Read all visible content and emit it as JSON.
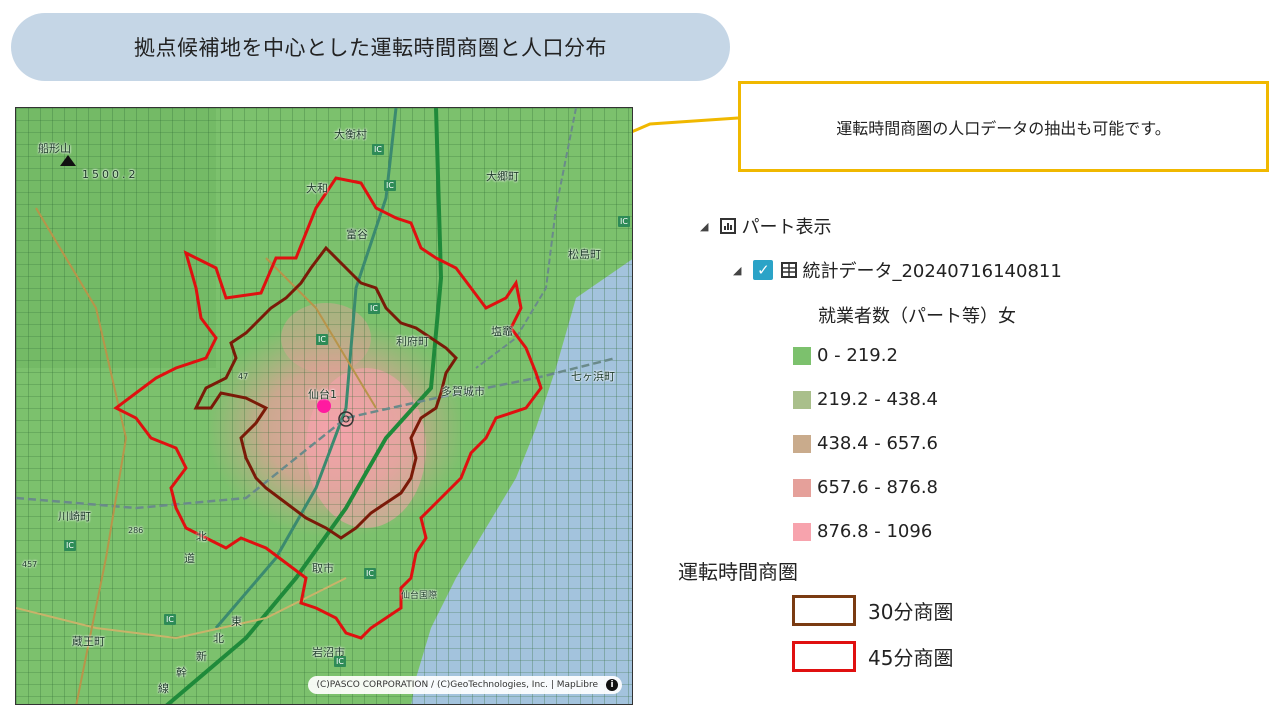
{
  "title": "拠点候補地を中心とした運転時間商圏と人口分布",
  "callout": "運転時間商圏の人口データの抽出も可能です。",
  "map": {
    "labels": {
      "mountain": "船形山",
      "elevation": "1500.2",
      "taiwa_mura": "大衡村",
      "daigo_machi": "大郷町",
      "taiwa": "大和",
      "tomiya": "富谷",
      "matsushima": "松島町",
      "rifu": "利府町",
      "shiogama": "塩竈",
      "shichigahama": "七ヶ浜町",
      "tagajo": "多賀城市",
      "sendai": "仙台1",
      "kawasaki": "川崎町",
      "natori": "取市",
      "airport": "仙台国際",
      "zao": "蔵王町",
      "iwanuma": "岩沼市",
      "kita": "北",
      "michi": "道",
      "higashi": "東",
      "shin": "新",
      "kan": "幹",
      "sen": "線",
      "route457": "457",
      "route286": "286",
      "route47": "47"
    },
    "ic_label": "IC",
    "attribution": "(C)PASCO CORPORATION / (C)GeoTechnologies, Inc. | MapLibre",
    "info_icon": "i"
  },
  "panel": {
    "part_label": "パート表示",
    "dataset_label": "統計データ_20240716140811",
    "metric_label": "就業者数（パート等）女",
    "legend": [
      {
        "label": "0 - 219.2",
        "color": "#7cc16d"
      },
      {
        "label": "219.2 - 438.4",
        "color": "#a9bf8b"
      },
      {
        "label": "438.4 - 657.6",
        "color": "#c9ab8c"
      },
      {
        "label": "657.6 - 876.8",
        "color": "#e5a09a"
      },
      {
        "label": "876.8 - 1096",
        "color": "#f7a3ad"
      }
    ],
    "trade_title": "運転時間商圏",
    "trade": [
      {
        "label": "30分商圏",
        "color": "#7a3b12"
      },
      {
        "label": "45分商圏",
        "color": "#e01010"
      }
    ]
  }
}
